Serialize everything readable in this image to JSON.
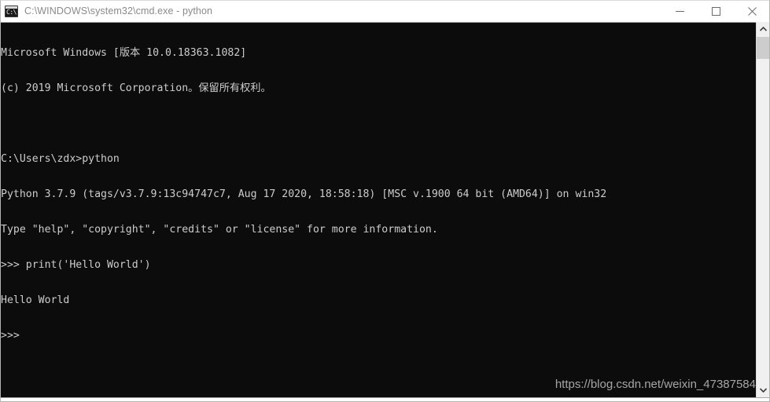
{
  "window": {
    "title": "C:\\WINDOWS\\system32\\cmd.exe - python",
    "icon_name": "cmd-console-icon",
    "icon_glyph": "C:\\",
    "controls": {
      "minimize_label": "Minimize",
      "maximize_label": "Maximize",
      "close_label": "Close"
    },
    "colors": {
      "titlebar_background": "#ffffff",
      "title_text": "#8a8a8a",
      "console_background": "#0c0c0c",
      "console_text": "#cccccc",
      "scrollbar_track": "#f0f0f0",
      "scrollbar_thumb": "#cdcdcd",
      "watermark_text": "#a6a6a6"
    }
  },
  "console": {
    "lines": [
      "Microsoft Windows [版本 10.0.18363.1082]",
      "(c) 2019 Microsoft Corporation。保留所有权利。",
      "",
      "C:\\Users\\zdx>python",
      "Python 3.7.9 (tags/v3.7.9:13c94747c7, Aug 17 2020, 18:58:18) [MSC v.1900 64 bit (AMD64)] on win32",
      "Type \"help\", \"copyright\", \"credits\" or \"license\" for more information.",
      ">>> print('Hello World')",
      "Hello World",
      ">>>"
    ]
  },
  "watermark": {
    "text": "https://blog.csdn.net/weixin_47387584"
  },
  "scrollbar": {
    "up_arrow_name": "chevron-up-icon",
    "down_arrow_name": "chevron-down-icon"
  }
}
